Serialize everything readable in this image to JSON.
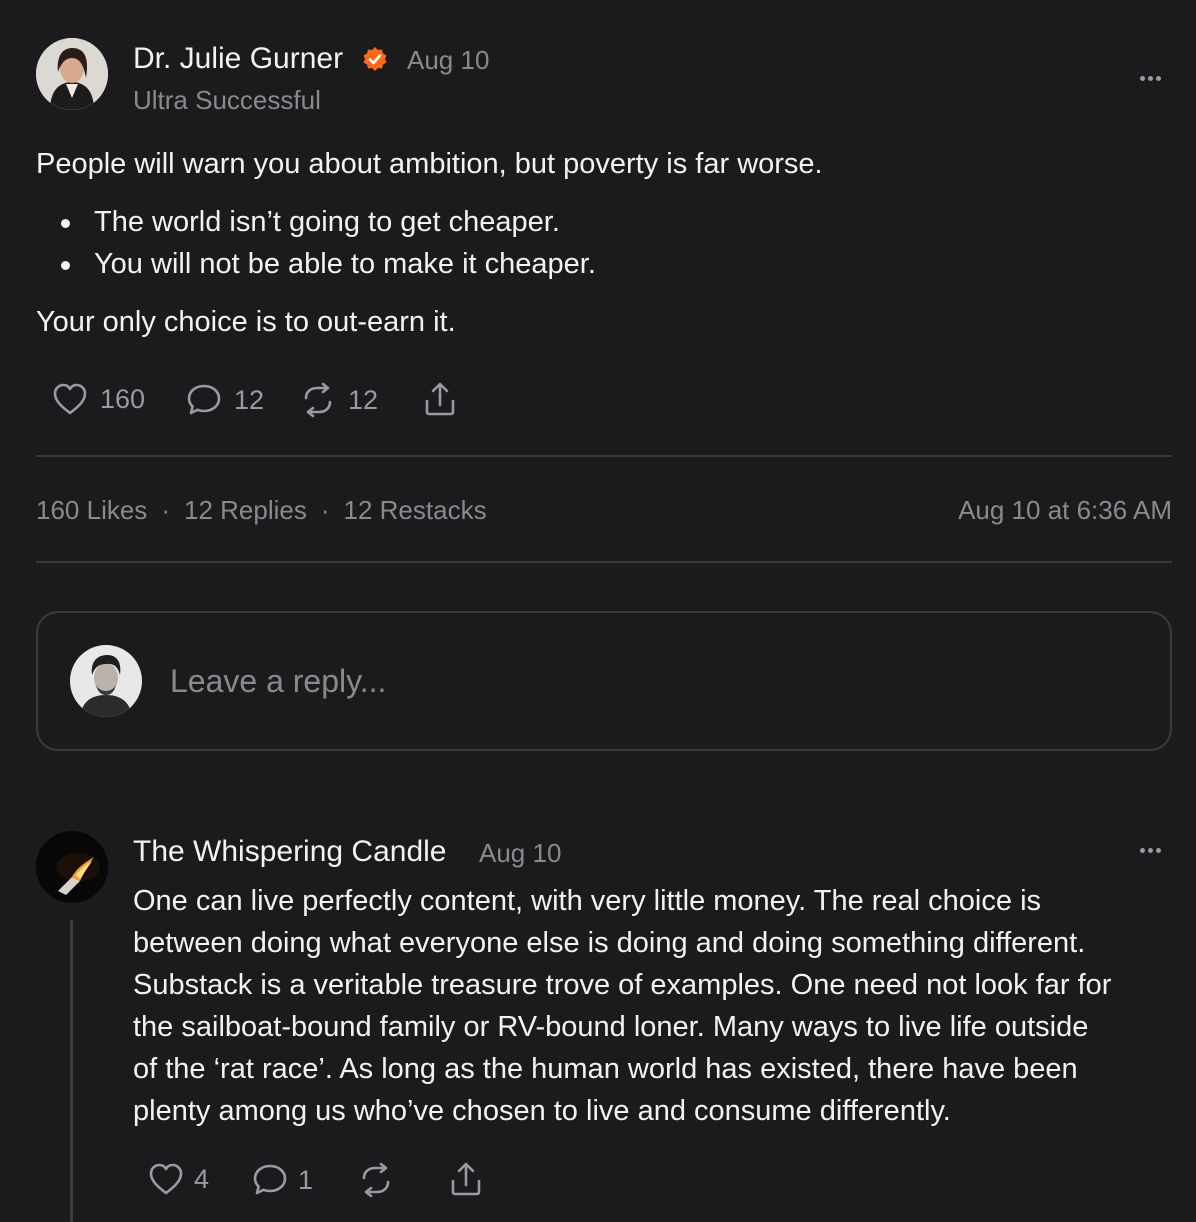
{
  "post": {
    "author": "Dr. Julie Gurner",
    "date": "Aug 10",
    "publication": "Ultra Successful",
    "intro": "People will warn you about ambition, but poverty is far worse.",
    "bullets": [
      "The world isn’t going to get cheaper.",
      "You will not be able to make it cheaper."
    ],
    "closing": "Your only choice is to out-earn it.",
    "actions": {
      "likes": "160",
      "comments": "12",
      "restacks": "12"
    },
    "stats": {
      "likes": "160 Likes",
      "replies": "12 Replies",
      "restacks": "12 Restacks",
      "separator": "·",
      "timestamp": "Aug 10 at 6:36 AM"
    },
    "verified_color": "#ff6719"
  },
  "reply": {
    "placeholder": "Leave a reply..."
  },
  "comment": {
    "author": "The Whispering Candle",
    "date": "Aug 10",
    "lines": [
      "One can live perfectly content, with very little money. The real choice is",
      "between doing what everyone else is doing and doing something different.",
      "Substack is a veritable treasure trove of examples. One need not look far for",
      "the sailboat-bound family or RV-bound loner. Many ways to live life outside",
      "of the ‘rat race’. As long as the human world has existed, there have been",
      "plenty among us who’ve chosen to live and consume differently."
    ],
    "actions": {
      "likes": "4",
      "comments": "1"
    }
  },
  "icons": [
    "avatar",
    "verified-icon",
    "more-icon",
    "heart-icon",
    "comment-icon",
    "restack-icon",
    "share-icon"
  ]
}
